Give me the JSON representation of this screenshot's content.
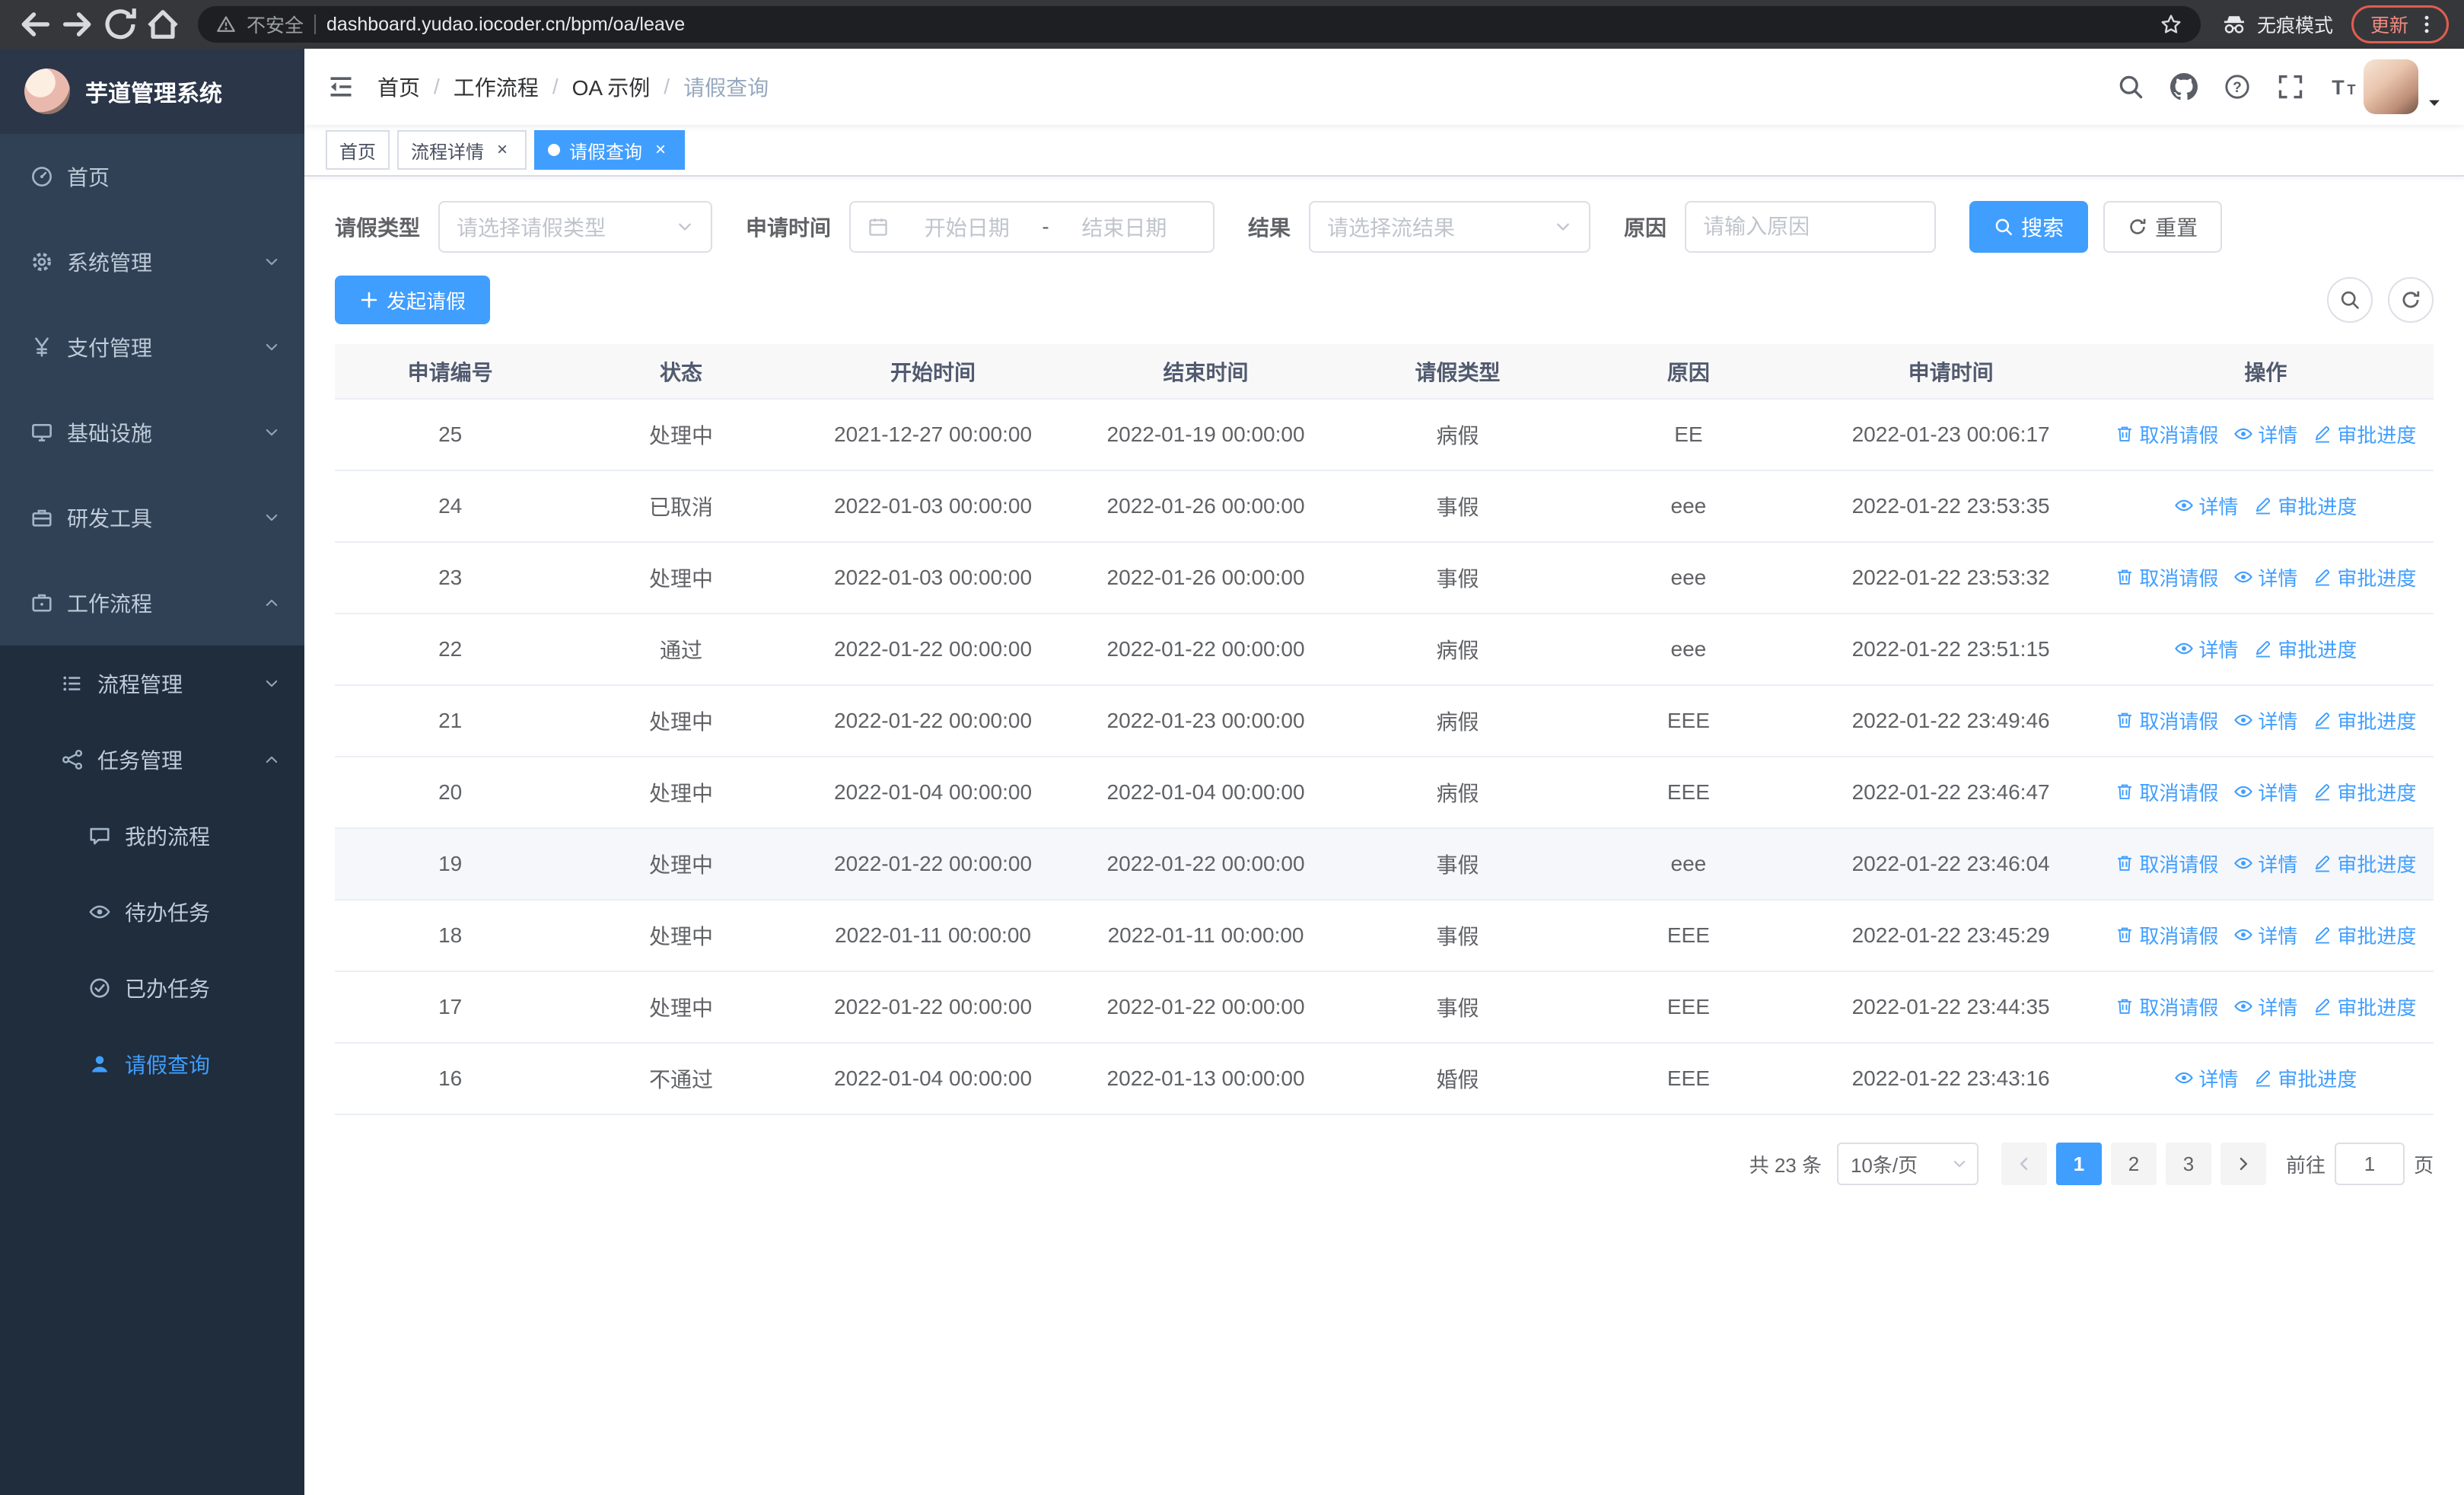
{
  "browser": {
    "security_label": "不安全",
    "url": "dashboard.yudao.iocoder.cn/bpm/oa/leave",
    "incognito_label": "无痕模式",
    "update_label": "更新",
    "nav_icons": [
      "back-icon",
      "forward-icon",
      "refresh-icon",
      "home-icon"
    ]
  },
  "sidebar": {
    "logo_title": "芋道管理系统",
    "items": [
      {
        "label": "首页",
        "icon": "dashboard-icon",
        "level": 1
      },
      {
        "label": "系统管理",
        "icon": "gear-icon",
        "level": 1,
        "chevron": "down"
      },
      {
        "label": "支付管理",
        "icon": "yen-icon",
        "level": 1,
        "chevron": "down"
      },
      {
        "label": "基础设施",
        "icon": "monitor-icon",
        "level": 1,
        "chevron": "down"
      },
      {
        "label": "研发工具",
        "icon": "toolbox-icon",
        "level": 1,
        "chevron": "down"
      },
      {
        "label": "工作流程",
        "icon": "briefcase-icon",
        "level": 1,
        "chevron": "up"
      },
      {
        "label": "流程管理",
        "icon": "list-icon",
        "level": 2,
        "chevron": "down"
      },
      {
        "label": "任务管理",
        "icon": "share-icon",
        "level": 2,
        "chevron": "up"
      },
      {
        "label": "我的流程",
        "icon": "chat-icon",
        "level": 3
      },
      {
        "label": "待办任务",
        "icon": "eye-icon",
        "level": 3
      },
      {
        "label": "已办任务",
        "icon": "check-circle-icon",
        "level": 3
      },
      {
        "label": "请假查询",
        "icon": "user-icon",
        "level": 3,
        "active": true
      }
    ]
  },
  "navbar": {
    "breadcrumb": [
      "首页",
      "工作流程",
      "OA 示例",
      "请假查询"
    ],
    "icons": [
      "search-icon",
      "github-icon",
      "question-icon",
      "fullscreen-icon",
      "font-size-icon"
    ]
  },
  "tabs": [
    {
      "label": "首页",
      "closable": false,
      "active": false
    },
    {
      "label": "流程详情",
      "closable": true,
      "active": false
    },
    {
      "label": "请假查询",
      "closable": true,
      "active": true
    }
  ],
  "filters": {
    "leave_type": {
      "label": "请假类型",
      "placeholder": "请选择请假类型"
    },
    "apply_time": {
      "label": "申请时间",
      "start_placeholder": "开始日期",
      "separator": "-",
      "end_placeholder": "结束日期"
    },
    "result": {
      "label": "结果",
      "placeholder": "请选择流结果"
    },
    "reason": {
      "label": "原因",
      "placeholder": "请输入原因"
    },
    "search_label": "搜索",
    "reset_label": "重置"
  },
  "toolbar": {
    "create_label": "发起请假"
  },
  "table": {
    "columns": [
      "申请编号",
      "状态",
      "开始时间",
      "结束时间",
      "请假类型",
      "原因",
      "申请时间",
      "操作"
    ],
    "actions": {
      "cancel": {
        "label": "取消请假",
        "icon": "trash-icon"
      },
      "detail": {
        "label": "详情",
        "icon": "eye-icon"
      },
      "progress": {
        "label": "审批进度",
        "icon": "pen-icon"
      }
    },
    "rows": [
      {
        "id": "25",
        "status": "处理中",
        "start": "2021-12-27 00:00:00",
        "end": "2022-01-19 00:00:00",
        "type": "病假",
        "reason": "EE",
        "apply_time": "2022-01-23 00:06:17",
        "cancelable": true
      },
      {
        "id": "24",
        "status": "已取消",
        "start": "2022-01-03 00:00:00",
        "end": "2022-01-26 00:00:00",
        "type": "事假",
        "reason": "eee",
        "apply_time": "2022-01-22 23:53:35",
        "cancelable": false
      },
      {
        "id": "23",
        "status": "处理中",
        "start": "2022-01-03 00:00:00",
        "end": "2022-01-26 00:00:00",
        "type": "事假",
        "reason": "eee",
        "apply_time": "2022-01-22 23:53:32",
        "cancelable": true
      },
      {
        "id": "22",
        "status": "通过",
        "start": "2022-01-22 00:00:00",
        "end": "2022-01-22 00:00:00",
        "type": "病假",
        "reason": "eee",
        "apply_time": "2022-01-22 23:51:15",
        "cancelable": false
      },
      {
        "id": "21",
        "status": "处理中",
        "start": "2022-01-22 00:00:00",
        "end": "2022-01-23 00:00:00",
        "type": "病假",
        "reason": "EEE",
        "apply_time": "2022-01-22 23:49:46",
        "cancelable": true
      },
      {
        "id": "20",
        "status": "处理中",
        "start": "2022-01-04 00:00:00",
        "end": "2022-01-04 00:00:00",
        "type": "病假",
        "reason": "EEE",
        "apply_time": "2022-01-22 23:46:47",
        "cancelable": true
      },
      {
        "id": "19",
        "status": "处理中",
        "start": "2022-01-22 00:00:00",
        "end": "2022-01-22 00:00:00",
        "type": "事假",
        "reason": "eee",
        "apply_time": "2022-01-22 23:46:04",
        "cancelable": true,
        "highlighted": true
      },
      {
        "id": "18",
        "status": "处理中",
        "start": "2022-01-11 00:00:00",
        "end": "2022-01-11 00:00:00",
        "type": "事假",
        "reason": "EEE",
        "apply_time": "2022-01-22 23:45:29",
        "cancelable": true
      },
      {
        "id": "17",
        "status": "处理中",
        "start": "2022-01-22 00:00:00",
        "end": "2022-01-22 00:00:00",
        "type": "事假",
        "reason": "EEE",
        "apply_time": "2022-01-22 23:44:35",
        "cancelable": true
      },
      {
        "id": "16",
        "status": "不通过",
        "start": "2022-01-04 00:00:00",
        "end": "2022-01-13 00:00:00",
        "type": "婚假",
        "reason": "EEE",
        "apply_time": "2022-01-22 23:43:16",
        "cancelable": false
      }
    ]
  },
  "pagination": {
    "total_label": "共 23 条",
    "page_size_value": "10条/页",
    "pages": [
      "1",
      "2",
      "3"
    ],
    "active_page": "1",
    "goto_label": "前往",
    "goto_value": "1",
    "goto_unit": "页"
  },
  "colors": {
    "primary": "#409EFF",
    "sidebar_bg": "#304156",
    "sidebar_sub_bg": "#1f2d3d",
    "active_tab_bg": "#409EFF"
  }
}
